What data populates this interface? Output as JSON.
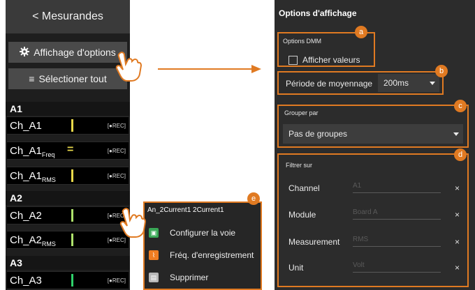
{
  "colors": {
    "accent": "#e07a22",
    "panel": "#2c2c2c"
  },
  "left": {
    "header": "< Mesurandes",
    "options_button": "Affichage d'options",
    "select_all_button": "Sélectioner tout",
    "select_all_icon": "≡",
    "groups": [
      {
        "label": "A1",
        "rows": [
          {
            "name": "Ch_A1",
            "sub": "",
            "bar": "#e8d84a",
            "rec": "[●REC]"
          },
          {
            "name": "Ch_A1",
            "sub": "Freq",
            "bar": "#e8d84a",
            "rec": "[●REC]"
          },
          {
            "name": "Ch_A1",
            "sub": "RMS",
            "bar": "#e8d84a",
            "rec": "[●REC]"
          }
        ]
      },
      {
        "label": "A2",
        "rows": [
          {
            "name": "Ch_A2",
            "sub": "",
            "bar": "#aee26b",
            "rec": "[●REC]"
          },
          {
            "name": "Ch_A2",
            "sub": "RMS",
            "bar": "#aee26b",
            "rec": "[●REC]"
          }
        ]
      },
      {
        "label": "A3",
        "rows": [
          {
            "name": "Ch_A3",
            "sub": "",
            "bar": "#2fd06a",
            "rec": "[●REC]"
          }
        ]
      }
    ]
  },
  "context_menu": {
    "title": "An_2Current1 2Current1",
    "badge": "e",
    "items": [
      {
        "label": "Configurer la voie",
        "icon": "configure-icon",
        "color": "#3aa857"
      },
      {
        "label": "Fréq. d'enregistrement",
        "icon": "frequency-icon",
        "color": "#f07d22"
      },
      {
        "label": "Supprimer",
        "icon": "delete-icon",
        "color": "#b8b8b8"
      }
    ]
  },
  "right": {
    "title": "Options d'affichage",
    "dmm": {
      "badge": "a",
      "section": "Options DMM",
      "checkbox_label": "Afficher valeurs"
    },
    "period": {
      "badge": "b",
      "label": "Période de moyennage",
      "value": "200ms"
    },
    "group": {
      "badge": "c",
      "label": "Grouper par",
      "value": "Pas de groupes"
    },
    "filter": {
      "badge": "d",
      "label": "Filtrer sur",
      "rows": [
        {
          "label": "Channel",
          "value": "A1",
          "clear": "×"
        },
        {
          "label": "Module",
          "value": "Board A",
          "clear": "×"
        },
        {
          "label": "Measurement",
          "value": "RMS",
          "clear": "×"
        },
        {
          "label": "Unit",
          "value": "Volt",
          "clear": "×"
        }
      ]
    }
  }
}
